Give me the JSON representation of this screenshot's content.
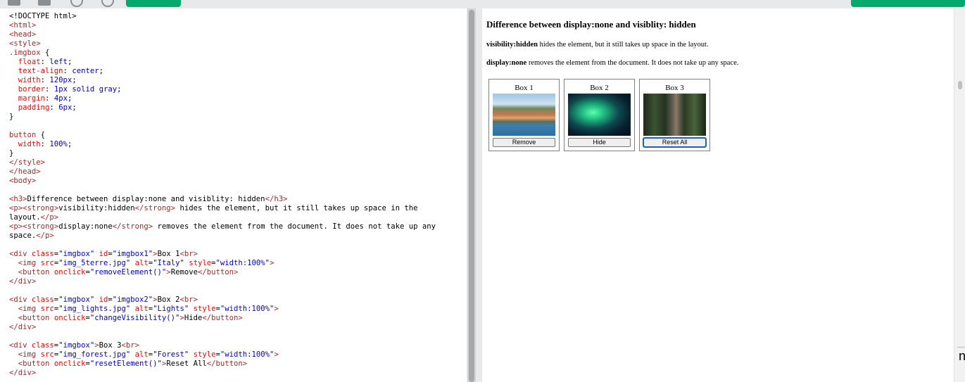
{
  "toolbar": {
    "icons": [
      "menu-icon",
      "square-icon",
      "compass-icon",
      "circle-icon"
    ],
    "run_button_color": "#04aa6d"
  },
  "editor": {
    "lines": [
      "<!DOCTYPE html>",
      "<html>",
      "<head>",
      "<style>",
      ".imgbox {",
      "  float: left;",
      "  text-align: center;",
      "  width: 120px;",
      "  border: 1px solid gray;",
      "  margin: 4px;",
      "  padding: 6px;",
      "}",
      "",
      "button {",
      "  width: 100%;",
      "}",
      "</style>",
      "</head>",
      "<body>",
      "",
      "<h3>Difference between display:none and visiblity: hidden</h3>",
      "<p><strong>visibility:hidden</strong> hides the element, but it still takes up space in the",
      "layout.</p>",
      "<p><strong>display:none</strong> removes the element from the document. It does not take up any",
      "space.</p>",
      "",
      "<div class=\"imgbox\" id=\"imgbox1\">Box 1<br>",
      "  <img src=\"img_5terre.jpg\" alt=\"Italy\" style=\"width:100%\">",
      "  <button onclick=\"removeElement()\">Remove</button>",
      "</div>",
      "",
      "<div class=\"imgbox\" id=\"imgbox2\">Box 2<br>",
      "  <img src=\"img_lights.jpg\" alt=\"Lights\" style=\"width:100%\">",
      "  <button onclick=\"changeVisibility()\">Hide</button>",
      "</div>",
      "",
      "<div class=\"imgbox\">Box 3<br>",
      "  <img src=\"img_forest.jpg\" alt=\"Forest\" style=\"width:100%\">",
      "  <button onclick=\"resetElement()\">Reset All</button>",
      "</div>"
    ]
  },
  "result": {
    "heading": "Difference between display:none and visiblity: hidden",
    "p1_strong": "visibility:hidden",
    "p1_text": " hides the element, but it still takes up space in the layout.",
    "p2_strong": "display:none",
    "p2_text": " removes the element from the document. It does not take up any space.",
    "boxes": [
      {
        "caption": "Box 1",
        "alt": "Italy",
        "button": "Remove"
      },
      {
        "caption": "Box 2",
        "alt": "Lights",
        "button": "Hide"
      },
      {
        "caption": "Box 3",
        "alt": "Forest",
        "button": "Reset All"
      }
    ]
  },
  "edge_text": "n"
}
